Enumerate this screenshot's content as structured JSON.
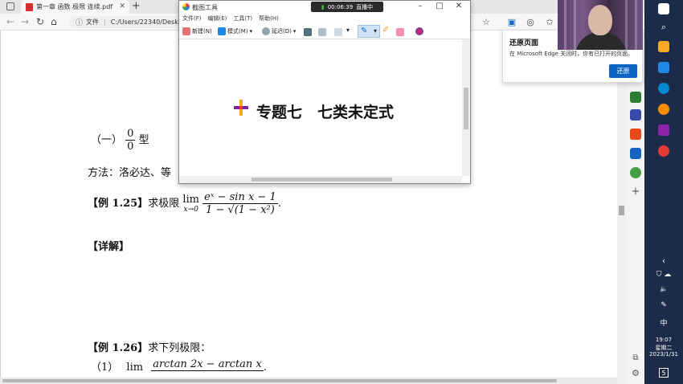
{
  "browser": {
    "tab_title": "第一章 函数 极限 连续.pdf",
    "tab_close": "✕",
    "new_tab": "+",
    "back": "←",
    "forward": "→",
    "refresh": "↻",
    "home": "⌂",
    "url_label": "文件",
    "url_path": "C:/Users/22340/Desktop/"
  },
  "pdf": {
    "type_label": "（一）",
    "frac_num": "0",
    "frac_den": "0",
    "type_suffix": "型",
    "method_text": "方法：洛必达、等",
    "ex125_label": "【例 1.25】",
    "ex125_text": "求极限",
    "ex125_lim": "lim",
    "ex125_sub": "x→0",
    "ex125_num": "eˣ − sin x − 1",
    "ex125_den": "1 − √(1 − x²)",
    "ex125_end": ".",
    "detail_label": "【详解】",
    "ex126_label": "【例 1.26】",
    "ex126_text": "求下列极限：",
    "ex126_item": "（1）",
    "ex126_lim": "lim",
    "ex126_num": "arctan 2x − arctan x",
    "ex126_end": "."
  },
  "snip": {
    "title": "截图工具",
    "rec_time": "00:06:39",
    "rec_status": "直播中",
    "menu": [
      "文件(F)",
      "编辑(E)",
      "工具(T)",
      "帮助(H)"
    ],
    "new_label": "新建(N)",
    "mode_label": "模式(M)",
    "delay_label": "延迟(D)",
    "heading": "专题七　七类未定式"
  },
  "restore": {
    "title": "还原页面",
    "message": "在 Microsoft Edge 关闭时，你有已打开的页面。",
    "button": "还原"
  },
  "taskbar": {
    "time": "19:07",
    "weekday": "星期二",
    "date": "2023/1/31",
    "lang": "中",
    "notif_count": "5"
  },
  "colors": {
    "taskbar_bg": "#1c2b4a",
    "accent_blue": "#0a66c2",
    "pdf_icon": "#d32f2f"
  }
}
